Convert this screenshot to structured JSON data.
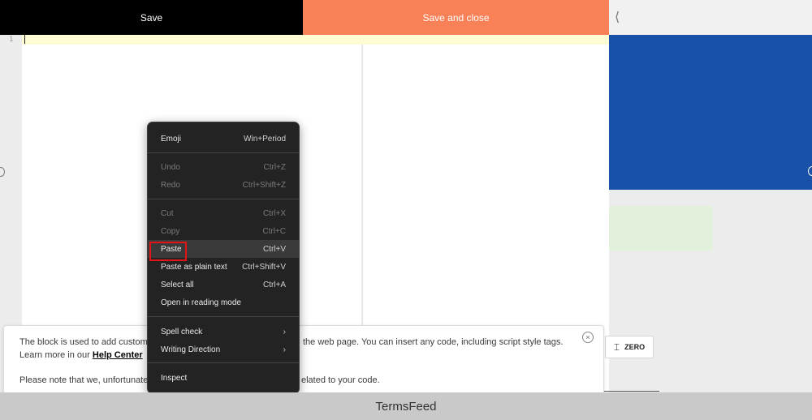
{
  "toolbar": {
    "save_label": "Save",
    "save_close_label": "Save and close",
    "collapse_icon": "chevron-left-icon",
    "collapse_glyph": "⟨"
  },
  "editor": {
    "line_number": "1"
  },
  "context_menu": {
    "emoji": {
      "label": "Emoji",
      "shortcut": "Win+Period"
    },
    "undo": {
      "label": "Undo",
      "shortcut": "Ctrl+Z"
    },
    "redo": {
      "label": "Redo",
      "shortcut": "Ctrl+Shift+Z"
    },
    "cut": {
      "label": "Cut",
      "shortcut": "Ctrl+X"
    },
    "copy": {
      "label": "Copy",
      "shortcut": "Ctrl+C"
    },
    "paste": {
      "label": "Paste",
      "shortcut": "Ctrl+V"
    },
    "paste_plain": {
      "label": "Paste as plain text",
      "shortcut": "Ctrl+Shift+V"
    },
    "select_all": {
      "label": "Select all",
      "shortcut": "Ctrl+A"
    },
    "reading_mode": {
      "label": "Open in reading mode"
    },
    "spell_check": {
      "label": "Spell check",
      "arrow": "›"
    },
    "writing_direction": {
      "label": "Writing Direction",
      "arrow": "›"
    },
    "inspect": {
      "label": "Inspect"
    }
  },
  "notice": {
    "line1_left": "The block is used to add custom",
    "line1_right": "the web page. You can insert any code, including script style tags.",
    "line2_prefix": "Learn more in our",
    "help_link": "Help Center",
    "line3_left": "Please note that we, unfortunate",
    "line3_right": "elated to your code.",
    "close_glyph": "×"
  },
  "preview": {
    "zero_label": "ZERO",
    "zero_glyph": "⌶"
  },
  "footer": {
    "text": "TermsFeed"
  },
  "colors": {
    "save_bg": "#000000",
    "save_close_bg": "#f98157",
    "preview_blue": "#1752a8",
    "highlight_red": "#e11515"
  }
}
